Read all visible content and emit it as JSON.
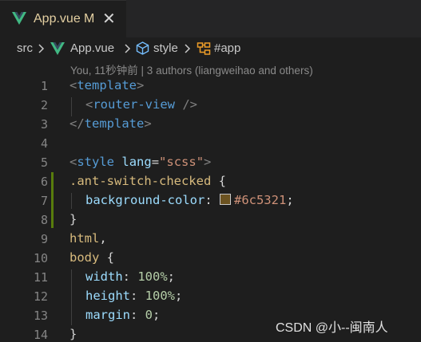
{
  "tab": {
    "filename": "App.vue",
    "modified_marker": "M",
    "close_glyph": "✕"
  },
  "breadcrumb": {
    "folder": "src",
    "file": "App.vue",
    "section": "style",
    "selector": "#app"
  },
  "blame": "You, 11秒钟前 | 3 authors (liangweihao and others)",
  "lines": [
    "1",
    "2",
    "3",
    "4",
    "5",
    "6",
    "7",
    "8",
    "9",
    "10",
    "11",
    "12",
    "13",
    "14"
  ],
  "code": {
    "l1": {
      "open": "<",
      "tag": "template",
      "close": ">"
    },
    "l2": {
      "open": "<",
      "tag": "router-view",
      "close": " />"
    },
    "l3": {
      "open": "</",
      "tag": "template",
      "close": ">"
    },
    "l5": {
      "open": "<",
      "tag": "style",
      "attr": "lang",
      "eq": "=",
      "val": "\"scss\"",
      "close": ">"
    },
    "l6": {
      "selector": ".ant-switch-checked",
      "brace": " {"
    },
    "l7": {
      "prop": "background-color",
      "colon": ": ",
      "value": "#6c5321",
      "semi": ";"
    },
    "l8": {
      "brace": "}"
    },
    "l9": {
      "selector": "html",
      "comma": ","
    },
    "l10": {
      "selector": "body",
      "brace": " {"
    },
    "l11": {
      "prop": "width",
      "colon": ": ",
      "value": "100%",
      "semi": ";"
    },
    "l12": {
      "prop": "height",
      "colon": ": ",
      "value": "100%",
      "semi": ";"
    },
    "l13": {
      "prop": "margin",
      "colon": ": ",
      "value": "0",
      "semi": ";"
    },
    "l14": {
      "brace": "}"
    }
  },
  "swatch_color": "#6c5321",
  "watermark": "CSDN @小--闽南人"
}
